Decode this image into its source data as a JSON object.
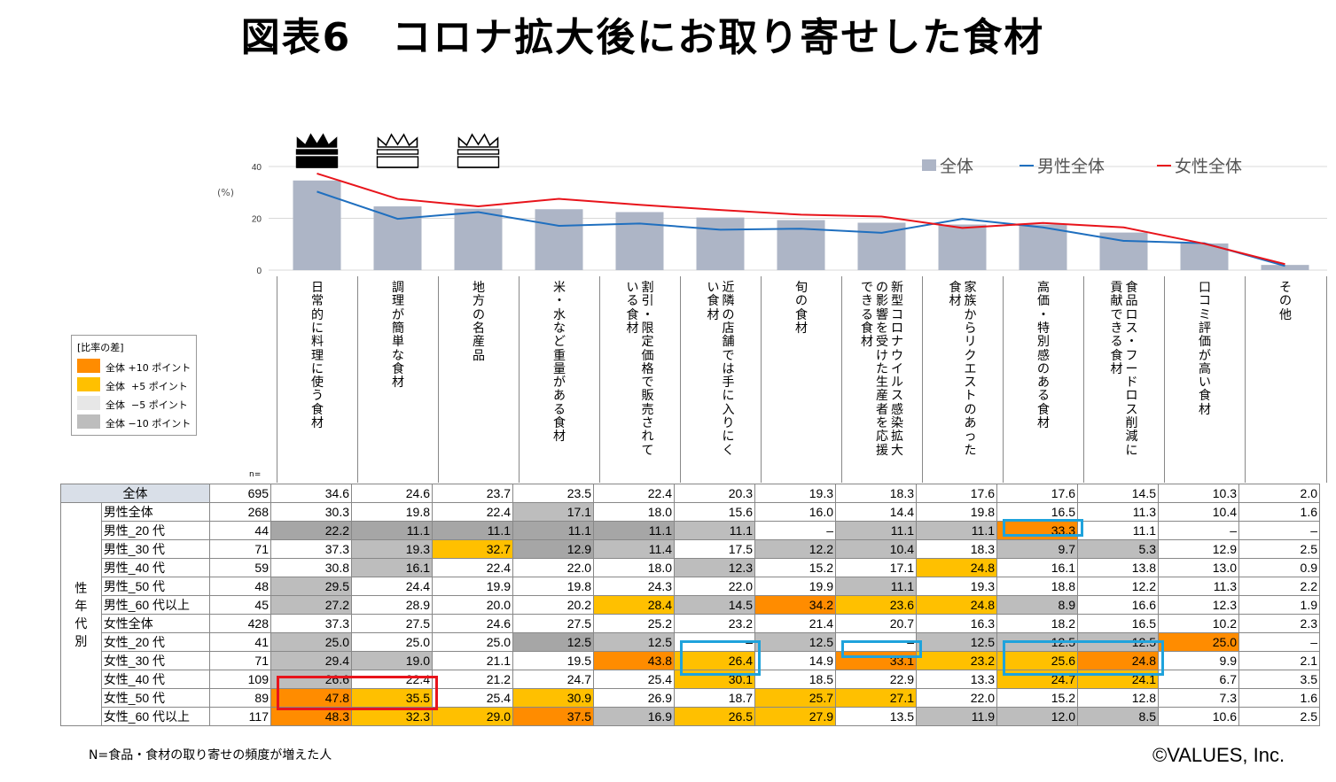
{
  "title": "図表6　コロナ拡大後にお取り寄せした食材",
  "y_unit": "(%)",
  "n_label": "n=",
  "legend_title": "[比率の差]",
  "legend_items": [
    {
      "label": "全体 +10 ポイント",
      "color": "#FF8C00"
    },
    {
      "label": "全体  +5 ポイント",
      "color": "#FFC000"
    },
    {
      "label": "全体  −5 ポイント",
      "color": "#E7E7E7"
    },
    {
      "label": "全体 −10 ポイント",
      "color": "#BDBDBD"
    }
  ],
  "group_label": "性年代別",
  "note": "N=食品・食材の取り寄せの頻度が増えた人",
  "copyright": "©VALUES, Inc.",
  "colors": {
    "bar": "#ADB5C6",
    "male": "#1F6FBF",
    "female": "#E8141B",
    "header_bg": "#D9DFE8",
    "orange": "#FF8C00",
    "yellow": "#FFC000",
    "light_gray": "#E7E7E7",
    "gray": "#BDBDBD",
    "dark_gray": "#A6A6A6"
  },
  "chart_data": {
    "type": "bar",
    "categories": [
      "日常的に料理に使う食材",
      "調理が簡単な食材",
      "地方の名産品",
      "米・水など重量がある食材",
      "割引・限定価格で販売されている食材",
      "近隣の店舗では手に入りにくい食材",
      "旬の食材",
      "新型コロナウイルス感染拡大の影響を受けた生産者を応援できる食材",
      "家族からリクエストのあった食材",
      "高価・特別感のある食材",
      "食品ロス・フードロス削減に貢献できる食材",
      "口コミ評価が高い食材",
      "その他"
    ],
    "series": [
      {
        "name": "全体",
        "type": "bar",
        "values": [
          34.6,
          24.6,
          23.7,
          23.5,
          22.4,
          20.3,
          19.3,
          18.3,
          17.6,
          17.6,
          14.5,
          10.3,
          2.0
        ]
      },
      {
        "name": "男性全体",
        "type": "line",
        "values": [
          30.3,
          19.8,
          22.4,
          17.1,
          18.0,
          15.6,
          16.0,
          14.4,
          19.8,
          16.5,
          11.3,
          10.4,
          1.6
        ]
      },
      {
        "name": "女性全体",
        "type": "line",
        "values": [
          37.3,
          27.5,
          24.6,
          27.5,
          25.2,
          23.2,
          21.4,
          20.7,
          16.3,
          18.2,
          16.5,
          10.2,
          2.3
        ]
      }
    ],
    "yticks": [
      0,
      20,
      40
    ],
    "ylim": [
      0,
      40
    ],
    "ylabel": "(%)",
    "legend_position": "top-right",
    "crowns": [
      {
        "index": 0,
        "style": "solid"
      },
      {
        "index": 1,
        "style": "outline"
      },
      {
        "index": 2,
        "style": "outline"
      }
    ],
    "table": {
      "rows": [
        {
          "label": "全体",
          "n": 695,
          "values": [
            "34.6",
            "24.6",
            "23.7",
            "23.5",
            "22.4",
            "20.3",
            "19.3",
            "18.3",
            "17.6",
            "17.6",
            "14.5",
            "10.3",
            "2.0"
          ],
          "shade": [
            "",
            "",
            "",
            "",
            "",
            "",
            "",
            "",
            "",
            "",
            "",
            "",
            ""
          ]
        },
        {
          "label": "男性全体",
          "n": 268,
          "values": [
            "30.3",
            "19.8",
            "22.4",
            "17.1",
            "18.0",
            "15.6",
            "16.0",
            "14.4",
            "19.8",
            "16.5",
            "11.3",
            "10.4",
            "1.6"
          ],
          "shade": [
            "",
            "",
            "",
            "g",
            "",
            "",
            "",
            "",
            "",
            "",
            "",
            "",
            ""
          ]
        },
        {
          "label": "男性_20 代",
          "n": 44,
          "values": [
            "22.2",
            "11.1",
            "11.1",
            "11.1",
            "11.1",
            "11.1",
            "–",
            "11.1",
            "11.1",
            "33.3",
            "11.1",
            "–",
            "–"
          ],
          "shade": [
            "dg",
            "dg",
            "dg",
            "dg",
            "dg",
            "g",
            "",
            "g",
            "g",
            "o",
            "",
            "",
            ""
          ]
        },
        {
          "label": "男性_30 代",
          "n": 71,
          "values": [
            "37.3",
            "19.3",
            "32.7",
            "12.9",
            "11.4",
            "17.5",
            "12.2",
            "10.4",
            "18.3",
            "9.7",
            "5.3",
            "12.9",
            "2.5"
          ],
          "shade": [
            "",
            "g",
            "y",
            "dg",
            "g",
            "",
            "g",
            "g",
            "",
            "g",
            "g",
            "",
            ""
          ]
        },
        {
          "label": "男性_40 代",
          "n": 59,
          "values": [
            "30.8",
            "16.1",
            "22.4",
            "22.0",
            "18.0",
            "12.3",
            "15.2",
            "17.1",
            "24.8",
            "16.1",
            "13.8",
            "13.0",
            "0.9"
          ],
          "shade": [
            "",
            "g",
            "",
            "",
            "",
            "g",
            "",
            "",
            "y",
            "",
            "",
            "",
            ""
          ]
        },
        {
          "label": "男性_50 代",
          "n": 48,
          "values": [
            "29.5",
            "24.4",
            "19.9",
            "19.8",
            "24.3",
            "22.0",
            "19.9",
            "11.1",
            "19.3",
            "18.8",
            "12.2",
            "11.3",
            "2.2"
          ],
          "shade": [
            "g",
            "",
            "",
            "",
            "",
            "",
            "",
            "g",
            "",
            "",
            "",
            "",
            ""
          ]
        },
        {
          "label": "男性_60 代以上",
          "n": 45,
          "values": [
            "27.2",
            "28.9",
            "20.0",
            "20.2",
            "28.4",
            "14.5",
            "34.2",
            "23.6",
            "24.8",
            "8.9",
            "16.6",
            "12.3",
            "1.9"
          ],
          "shade": [
            "g",
            "",
            "",
            "",
            "y",
            "g",
            "o",
            "y",
            "y",
            "g",
            "",
            "",
            ""
          ]
        },
        {
          "label": "女性全体",
          "n": 428,
          "values": [
            "37.3",
            "27.5",
            "24.6",
            "27.5",
            "25.2",
            "23.2",
            "21.4",
            "20.7",
            "16.3",
            "18.2",
            "16.5",
            "10.2",
            "2.3"
          ],
          "shade": [
            "",
            "",
            "",
            "",
            "",
            "",
            "",
            "",
            "",
            "",
            "",
            "",
            ""
          ]
        },
        {
          "label": "女性_20 代",
          "n": 41,
          "values": [
            "25.0",
            "25.0",
            "25.0",
            "12.5",
            "12.5",
            "–",
            "12.5",
            "–",
            "12.5",
            "12.5",
            "12.5",
            "25.0",
            "–"
          ],
          "shade": [
            "g",
            "",
            "",
            "dg",
            "g",
            "",
            "g",
            "",
            "g",
            "g",
            "g",
            "o",
            ""
          ]
        },
        {
          "label": "女性_30 代",
          "n": 71,
          "values": [
            "29.4",
            "19.0",
            "21.1",
            "19.5",
            "43.8",
            "26.4",
            "14.9",
            "33.1",
            "23.2",
            "25.6",
            "24.8",
            "9.9",
            "2.1"
          ],
          "shade": [
            "g",
            "g",
            "",
            "",
            "o",
            "y",
            "",
            "o",
            "y",
            "y",
            "o",
            "",
            ""
          ]
        },
        {
          "label": "女性_40 代",
          "n": 109,
          "values": [
            "26.6",
            "22.4",
            "21.2",
            "24.7",
            "25.4",
            "30.1",
            "18.5",
            "22.9",
            "13.3",
            "24.7",
            "24.1",
            "6.7",
            "3.5"
          ],
          "shade": [
            "g",
            "",
            "",
            "",
            "",
            "y",
            "",
            "",
            "",
            "y",
            "y",
            "",
            ""
          ]
        },
        {
          "label": "女性_50 代",
          "n": 89,
          "values": [
            "47.8",
            "35.5",
            "25.4",
            "30.9",
            "26.9",
            "18.7",
            "25.7",
            "27.1",
            "22.0",
            "15.2",
            "12.8",
            "7.3",
            "1.6"
          ],
          "shade": [
            "o",
            "y",
            "",
            "y",
            "",
            "",
            "y",
            "y",
            "",
            "",
            "",
            "",
            ""
          ]
        },
        {
          "label": "女性_60 代以上",
          "n": 117,
          "values": [
            "48.3",
            "32.3",
            "29.0",
            "37.5",
            "16.9",
            "26.5",
            "27.9",
            "13.5",
            "11.9",
            "12.0",
            "8.5",
            "10.6",
            "2.5"
          ],
          "shade": [
            "o",
            "y",
            "y",
            "o",
            "g",
            "y",
            "y",
            "",
            "g",
            "g",
            "g",
            "",
            ""
          ]
        }
      ]
    }
  }
}
